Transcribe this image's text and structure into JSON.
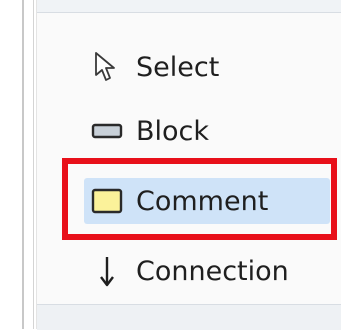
{
  "palette": {
    "tools": [
      {
        "id": "select",
        "label": "Select",
        "icon": "arrow-cursor-icon"
      },
      {
        "id": "block",
        "label": "Block",
        "icon": "block-rectangle-icon"
      },
      {
        "id": "comment",
        "label": "Comment",
        "icon": "comment-note-icon",
        "selected": true
      },
      {
        "id": "connection",
        "label": "Connection",
        "icon": "down-arrow-icon"
      }
    ]
  },
  "colors": {
    "selection_bg": "#cfe3f8",
    "highlight_border": "#e8101a",
    "comment_fill": "#fbf29a",
    "block_fill": "#c8d0d8"
  },
  "annotation": {
    "highlighted_item": "comment"
  }
}
